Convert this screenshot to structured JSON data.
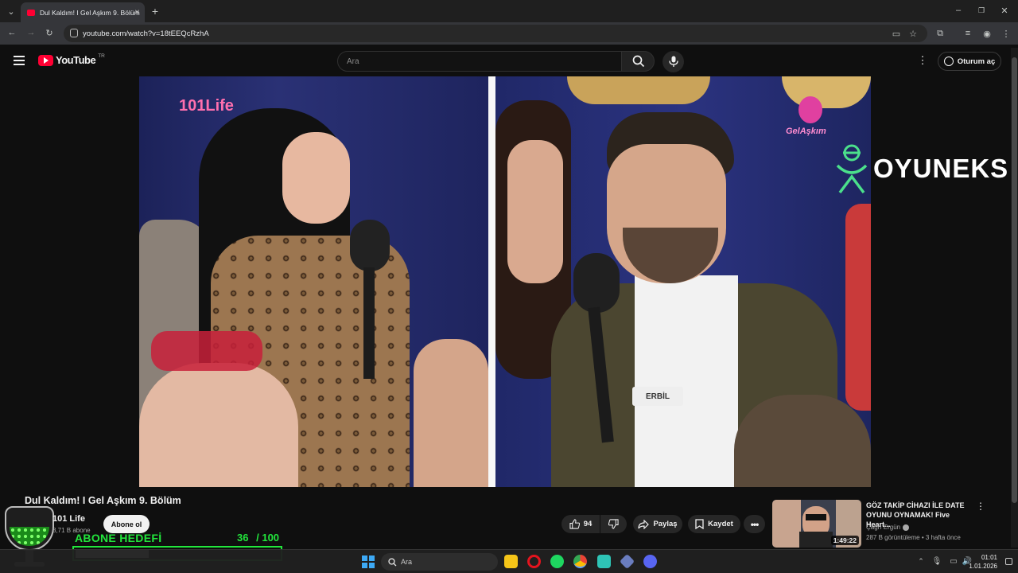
{
  "browser": {
    "tab_title": "Dul Kaldım! I Gel Aşkım 9. Bölüm",
    "url": "youtube.com/watch?v=18tEEQcRzhA"
  },
  "header": {
    "logo": "YouTube",
    "region": "TR",
    "search_placeholder": "Ara",
    "signin_label": "Oturum aç"
  },
  "video": {
    "brand_logo": "101Life",
    "show_logo": "GelAşkım",
    "sponsor": "OYUNEKS",
    "name_tag": "ERBİL",
    "title": "Dul Kaldım! I Gel Aşkım 9. Bölüm"
  },
  "channel": {
    "name": "101 Life",
    "subscribers": "3,71 B abone",
    "subscribe_label": "Abone ol"
  },
  "actions": {
    "likes": "94",
    "share": "Paylaş",
    "save": "Kaydet"
  },
  "recommended": {
    "title": "GÖZ TAKİP CİHAZI İLE DATE OYUNU OYNAMAK! Five Heart...",
    "channel": "Çağrı Ergün",
    "meta": "287 B görüntüleme • 3 hafta önce",
    "duration": "1:49:22"
  },
  "goal": {
    "label": "ABONE HEDEFİ",
    "current": 36,
    "separator": "/",
    "target": 100,
    "accent": "#22e63c"
  },
  "taskbar": {
    "search_label": "Ara",
    "time": "01:01",
    "date": "1.01.2026"
  }
}
